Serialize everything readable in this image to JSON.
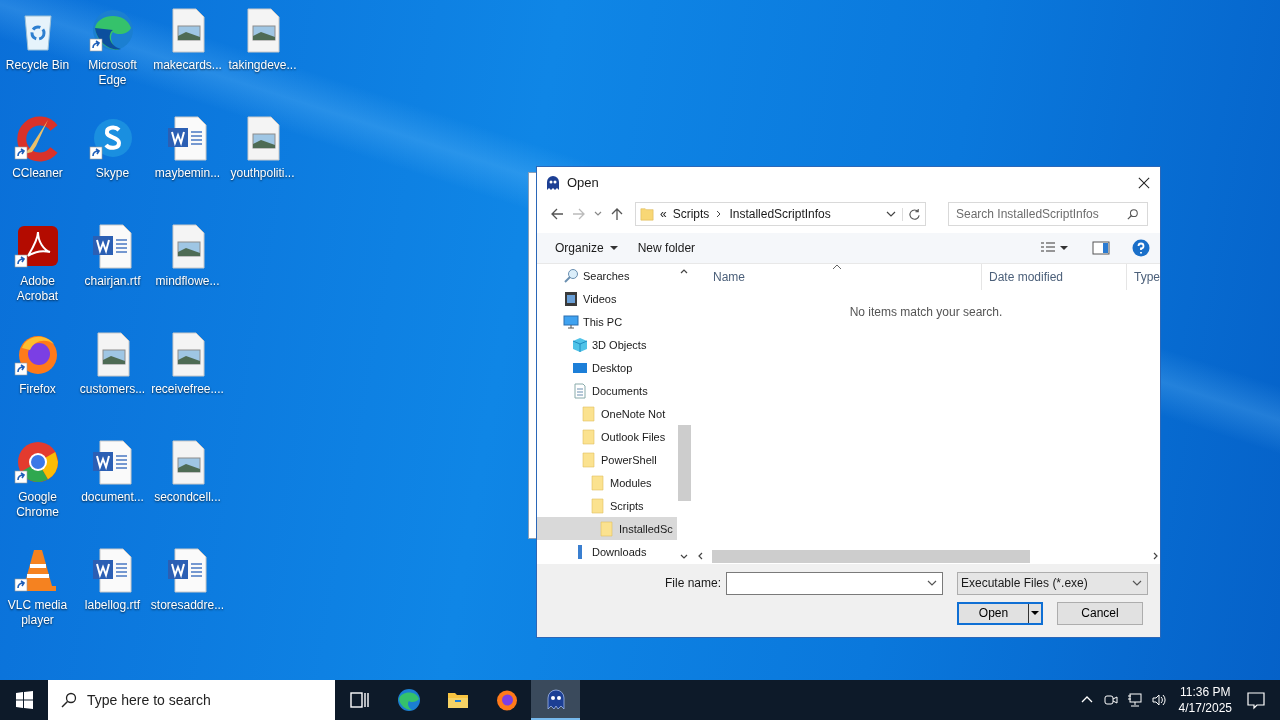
{
  "desktop": {
    "icons": [
      {
        "label": "Recycle Bin",
        "kind": "recycle",
        "shortcut": false
      },
      {
        "label": "CCleaner",
        "kind": "ccleaner",
        "shortcut": true
      },
      {
        "label": "Adobe Acrobat",
        "kind": "acrobat",
        "shortcut": true
      },
      {
        "label": "Firefox",
        "kind": "firefox",
        "shortcut": true
      },
      {
        "label": "Google Chrome",
        "kind": "chrome",
        "shortcut": true
      },
      {
        "label": "VLC media player",
        "kind": "vlc",
        "shortcut": true
      },
      {
        "label": "Microsoft Edge",
        "kind": "edge",
        "shortcut": true
      },
      {
        "label": "Skype",
        "kind": "skype",
        "shortcut": true
      },
      {
        "label": "chairjan.rtf",
        "kind": "word",
        "shortcut": false
      },
      {
        "label": "customers...",
        "kind": "image",
        "shortcut": false
      },
      {
        "label": "document...",
        "kind": "word",
        "shortcut": false
      },
      {
        "label": "labellog.rtf",
        "kind": "word",
        "shortcut": false
      },
      {
        "label": "makecards...",
        "kind": "image",
        "shortcut": false
      },
      {
        "label": "maybemin...",
        "kind": "word",
        "shortcut": false
      },
      {
        "label": "mindflowe...",
        "kind": "image",
        "shortcut": false
      },
      {
        "label": "receivefree....",
        "kind": "image",
        "shortcut": false
      },
      {
        "label": "secondcell...",
        "kind": "image",
        "shortcut": false
      },
      {
        "label": "storesaddre...",
        "kind": "word",
        "shortcut": false
      },
      {
        "label": "takingdeve...",
        "kind": "image",
        "shortcut": false
      },
      {
        "label": "youthpoliti...",
        "kind": "image",
        "shortcut": false
      }
    ]
  },
  "dialog": {
    "title": "Open",
    "address": {
      "overflow": "«",
      "path": [
        "Scripts",
        "InstalledScriptInfos"
      ]
    },
    "search": {
      "placeholder": "Search InstalledScriptInfos"
    },
    "toolbar": {
      "organize": "Organize",
      "new_folder": "New folder"
    },
    "tree": [
      {
        "children": [
          {
            "label": "Searches",
            "kind": "search",
            "selected": false
          },
          {
            "label": "Videos",
            "kind": "video",
            "selected": false
          }
        ]
      },
      {
        "label": "This PC",
        "kind": "pc",
        "selected": false,
        "children": [
          {
            "label": "3D Objects",
            "kind": "cube",
            "selected": false
          },
          {
            "label": "Desktop",
            "kind": "desktop",
            "selected": false
          },
          {
            "label": "Documents",
            "kind": "document",
            "selected": false,
            "children": [
              {
                "label": "OneNote Not",
                "kind": "folder",
                "selected": false
              },
              {
                "label": "Outlook Files",
                "kind": "folder",
                "selected": false
              },
              {
                "label": "PowerShell",
                "kind": "folder",
                "selected": false,
                "children": [
                  {
                    "label": "Modules",
                    "kind": "folder",
                    "selected": false
                  },
                  {
                    "label": "Scripts",
                    "kind": "folder",
                    "selected": false,
                    "children": [
                      {
                        "label": "InstalledSc",
                        "kind": "folder",
                        "selected": true
                      }
                    ]
                  }
                ]
              }
            ]
          },
          {
            "label": "Downloads",
            "kind": "download",
            "selected": false
          }
        ]
      }
    ],
    "columns": [
      "Name",
      "Date modified",
      "Type"
    ],
    "empty_message": "No items match your search.",
    "file_name": {
      "label": "File name:"
    },
    "file_type": "Executable Files (*.exe)",
    "buttons": [
      {
        "label": "Open",
        "default": true,
        "split": true
      },
      {
        "label": "Cancel",
        "default": false,
        "split": false
      }
    ]
  },
  "taskbar": {
    "search": {
      "placeholder": "Type here to search"
    },
    "apps": [
      {
        "kind": "taskview",
        "active": false
      },
      {
        "kind": "edge",
        "active": false
      },
      {
        "kind": "explorer",
        "active": false
      },
      {
        "kind": "firefox",
        "active": false
      },
      {
        "kind": "ghost",
        "active": true
      }
    ],
    "time": "11:36 PM",
    "date": "4/17/2025"
  }
}
